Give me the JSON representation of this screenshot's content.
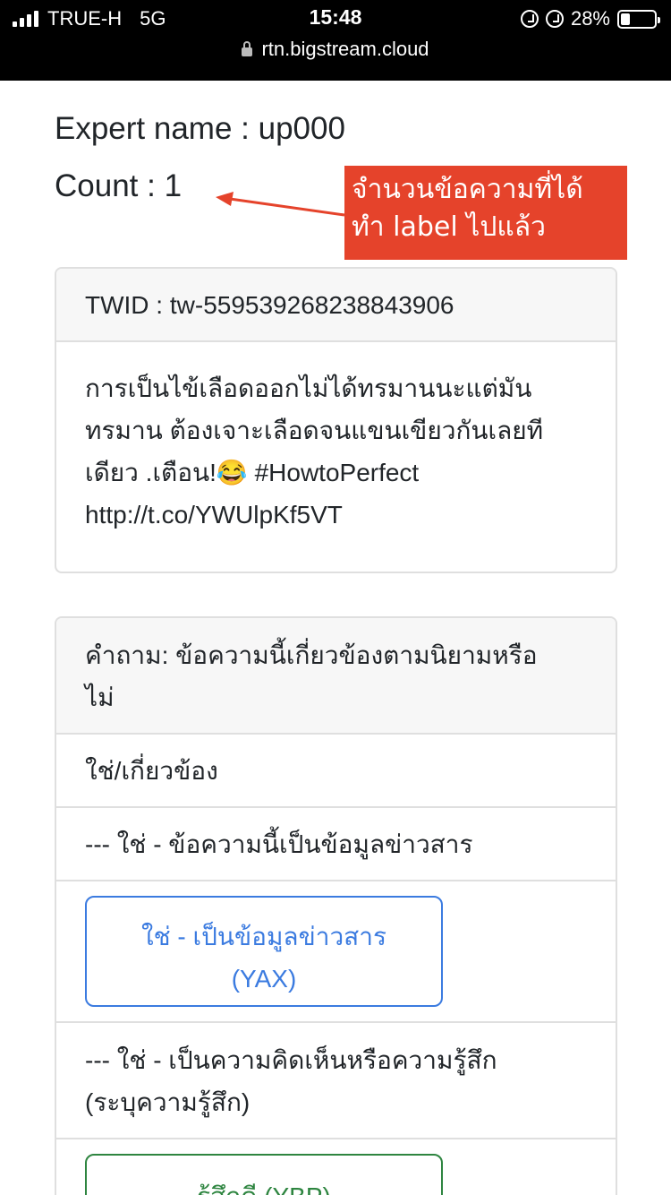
{
  "status_bar": {
    "carrier": "TRUE-H",
    "network": "5G",
    "time": "15:48",
    "battery": "28%",
    "battery_level": 0.28,
    "url": "rtn.bigstream.cloud"
  },
  "header": {
    "expert_label": "Expert name : up000",
    "count_label": "Count : 1"
  },
  "annotation": {
    "text_line1": "จำนวนข้อความที่ได้",
    "text_line2": "ทำ label ไปแล้ว",
    "color": "#e5432b"
  },
  "tweet": {
    "twid_label": "TWID : tw-559539268238843906",
    "line1": "การเป็นไข้เลือดออกไม่ได้ทรมานนะแต่มัน",
    "line2": "ทรมาน ต้องเจาะเลือดจนแขนเขียวกันเลยที",
    "line3": "เดียว .เตือน!😂 #HowtoPerfect",
    "line4": "http://t.co/YWUlpKf5VT"
  },
  "question": {
    "line1": "คำถาม: ข้อความนี้เกี่ยวข้องตามนิยามหรือ",
    "line2": "ไม่",
    "section_yes": "ใช่/เกี่ยวข้อง",
    "sub_info": "--- ใช่ - ข้อความนี้เป็นข้อมูลข่าวสาร",
    "btn_yax_line1": "ใช่ - เป็นข้อมูลข่าวสาร",
    "btn_yax_line2": "(YAX)",
    "sub_opinion_line1": "--- ใช่ - เป็นความคิดเห็นหรือความรู้สึก",
    "sub_opinion_line2": "(ระบุความรู้สึก)",
    "btn_ybp": "รู้สึกดี (YBP)"
  },
  "colors": {
    "link_blue": "#3b7be0",
    "success_green": "#2e8540"
  }
}
